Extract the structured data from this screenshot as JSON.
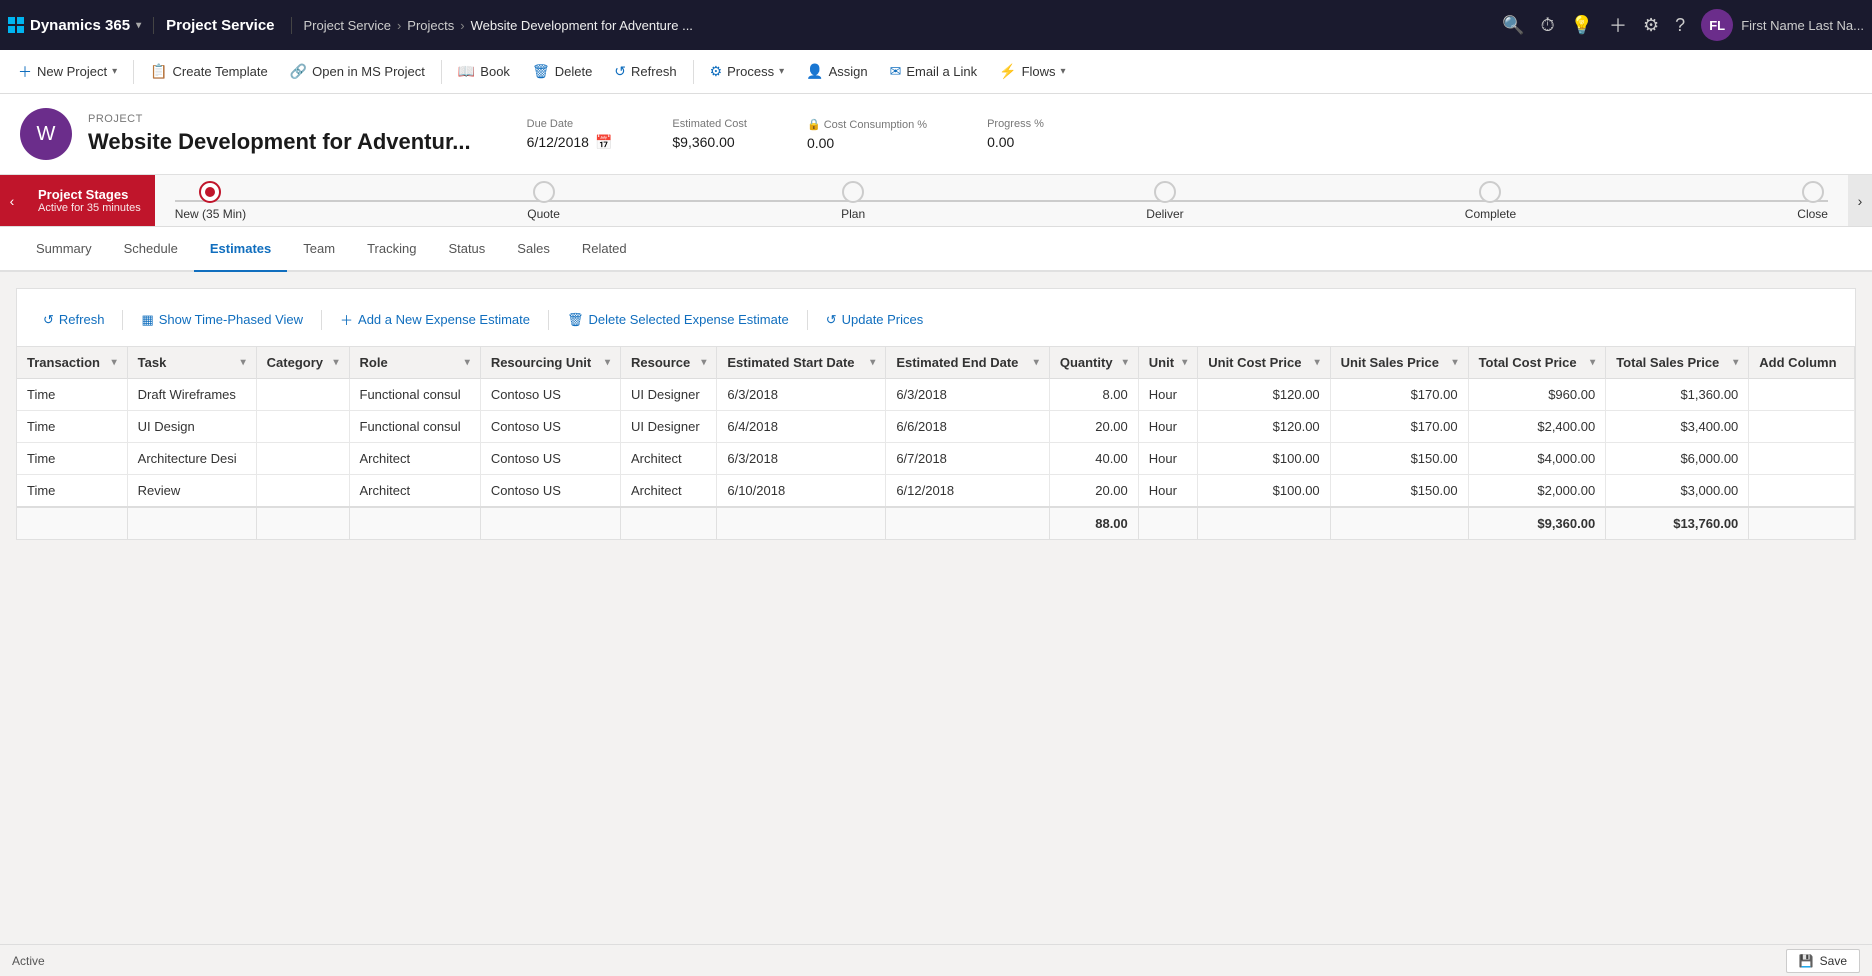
{
  "topNav": {
    "brand": "Dynamics 365",
    "brandChevron": "▾",
    "app": "Project Service",
    "breadcrumb": [
      "Project Service",
      "Projects",
      "Website Development for Adventure ..."
    ],
    "icons": [
      "🔍",
      "⏰",
      "💡",
      "＋",
      "⚙",
      "?"
    ],
    "userInitials": "FL",
    "userName": "First Name Last Na..."
  },
  "commandBar": {
    "buttons": [
      {
        "id": "new-project",
        "icon": "＋",
        "label": "New Project",
        "hasChevron": true
      },
      {
        "id": "create-template",
        "icon": "📋",
        "label": "Create Template",
        "hasChevron": false
      },
      {
        "id": "open-ms-project",
        "icon": "🔗",
        "label": "Open in MS Project",
        "hasChevron": false
      },
      {
        "id": "book",
        "icon": "📖",
        "label": "Book",
        "hasChevron": false
      },
      {
        "id": "delete",
        "icon": "🗑",
        "label": "Delete",
        "hasChevron": false
      },
      {
        "id": "refresh",
        "icon": "↺",
        "label": "Refresh",
        "hasChevron": false
      },
      {
        "id": "process",
        "icon": "⚙",
        "label": "Process",
        "hasChevron": true
      },
      {
        "id": "assign",
        "icon": "👤",
        "label": "Assign",
        "hasChevron": false
      },
      {
        "id": "email-link",
        "icon": "✉",
        "label": "Email a Link",
        "hasChevron": false
      },
      {
        "id": "flows",
        "icon": "⚡",
        "label": "Flows",
        "hasChevron": true
      }
    ]
  },
  "project": {
    "label": "PROJECT",
    "title": "Website Development for Adventur...",
    "iconLetter": "W",
    "dueDate": {
      "label": "Due Date",
      "value": "6/12/2018"
    },
    "estimatedCost": {
      "label": "Estimated Cost",
      "value": "$9,360.00"
    },
    "costConsumption": {
      "label": "Cost Consumption %",
      "value": "0.00"
    },
    "progress": {
      "label": "Progress %",
      "value": "0.00"
    }
  },
  "stageBar": {
    "sectionLabel": "Project Stages",
    "sectionTime": "Active for 35 minutes",
    "stages": [
      {
        "name": "New (35 Min)",
        "active": true
      },
      {
        "name": "Quote",
        "active": false
      },
      {
        "name": "Plan",
        "active": false
      },
      {
        "name": "Deliver",
        "active": false
      },
      {
        "name": "Complete",
        "active": false
      },
      {
        "name": "Close",
        "active": false
      }
    ]
  },
  "tabs": {
    "items": [
      {
        "id": "summary",
        "label": "Summary",
        "active": false
      },
      {
        "id": "schedule",
        "label": "Schedule",
        "active": false
      },
      {
        "id": "estimates",
        "label": "Estimates",
        "active": true
      },
      {
        "id": "team",
        "label": "Team",
        "active": false
      },
      {
        "id": "tracking",
        "label": "Tracking",
        "active": false
      },
      {
        "id": "status",
        "label": "Status",
        "active": false
      },
      {
        "id": "sales",
        "label": "Sales",
        "active": false
      },
      {
        "id": "related",
        "label": "Related",
        "active": false
      }
    ]
  },
  "estimatesToolbar": {
    "buttons": [
      {
        "id": "refresh",
        "icon": "↺",
        "label": "Refresh"
      },
      {
        "id": "show-time-phased",
        "icon": "▦",
        "label": "Show Time-Phased View"
      },
      {
        "id": "add-expense",
        "icon": "＋",
        "label": "Add a New Expense Estimate"
      },
      {
        "id": "delete-expense",
        "icon": "🗑",
        "label": "Delete Selected Expense Estimate"
      },
      {
        "id": "update-prices",
        "icon": "↺",
        "label": "Update Prices"
      }
    ]
  },
  "table": {
    "columns": [
      {
        "id": "transaction",
        "label": "Transaction",
        "hasSort": true
      },
      {
        "id": "task",
        "label": "Task",
        "hasSort": true
      },
      {
        "id": "category",
        "label": "Category",
        "hasSort": true
      },
      {
        "id": "role",
        "label": "Role",
        "hasSort": true
      },
      {
        "id": "resourcing-unit",
        "label": "Resourcing Unit",
        "hasSort": true
      },
      {
        "id": "resource",
        "label": "Resource",
        "hasSort": true
      },
      {
        "id": "est-start-date",
        "label": "Estimated Start Date",
        "hasSort": true
      },
      {
        "id": "est-end-date",
        "label": "Estimated End Date",
        "hasSort": true
      },
      {
        "id": "quantity",
        "label": "Quantity",
        "hasSort": true
      },
      {
        "id": "unit",
        "label": "Unit",
        "hasSort": true
      },
      {
        "id": "unit-cost-price",
        "label": "Unit Cost Price",
        "hasSort": true
      },
      {
        "id": "unit-sales-price",
        "label": "Unit Sales Price",
        "hasSort": true
      },
      {
        "id": "total-cost-price",
        "label": "Total Cost Price",
        "hasSort": true
      },
      {
        "id": "total-sales-price",
        "label": "Total Sales Price",
        "hasSort": true
      },
      {
        "id": "add-column",
        "label": "Add Column",
        "hasSort": false
      }
    ],
    "rows": [
      {
        "transaction": "Time",
        "task": "Draft Wireframes",
        "category": "",
        "role": "Functional consul",
        "resourcingUnit": "Contoso US",
        "resource": "UI Designer",
        "estStartDate": "6/3/2018",
        "estEndDate": "6/3/2018",
        "quantity": "8.00",
        "unit": "Hour",
        "unitCostPrice": "$120.00",
        "unitSalesPrice": "$170.00",
        "totalCostPrice": "$960.00",
        "totalSalesPrice": "$1,360.00"
      },
      {
        "transaction": "Time",
        "task": "UI Design",
        "category": "",
        "role": "Functional consul",
        "resourcingUnit": "Contoso US",
        "resource": "UI Designer",
        "estStartDate": "6/4/2018",
        "estEndDate": "6/6/2018",
        "quantity": "20.00",
        "unit": "Hour",
        "unitCostPrice": "$120.00",
        "unitSalesPrice": "$170.00",
        "totalCostPrice": "$2,400.00",
        "totalSalesPrice": "$3,400.00"
      },
      {
        "transaction": "Time",
        "task": "Architecture Desi",
        "category": "",
        "role": "Architect",
        "resourcingUnit": "Contoso US",
        "resource": "Architect",
        "estStartDate": "6/3/2018",
        "estEndDate": "6/7/2018",
        "quantity": "40.00",
        "unit": "Hour",
        "unitCostPrice": "$100.00",
        "unitSalesPrice": "$150.00",
        "totalCostPrice": "$4,000.00",
        "totalSalesPrice": "$6,000.00"
      },
      {
        "transaction": "Time",
        "task": "Review",
        "category": "",
        "role": "Architect",
        "resourcingUnit": "Contoso US",
        "resource": "Architect",
        "estStartDate": "6/10/2018",
        "estEndDate": "6/12/2018",
        "quantity": "20.00",
        "unit": "Hour",
        "unitCostPrice": "$100.00",
        "unitSalesPrice": "$150.00",
        "totalCostPrice": "$2,000.00",
        "totalSalesPrice": "$3,000.00"
      }
    ],
    "footer": {
      "quantity": "88.00",
      "totalCostPrice": "$9,360.00",
      "totalSalesPrice": "$13,760.00"
    }
  },
  "footer": {
    "status": "Active",
    "saveLabel": "Save"
  }
}
